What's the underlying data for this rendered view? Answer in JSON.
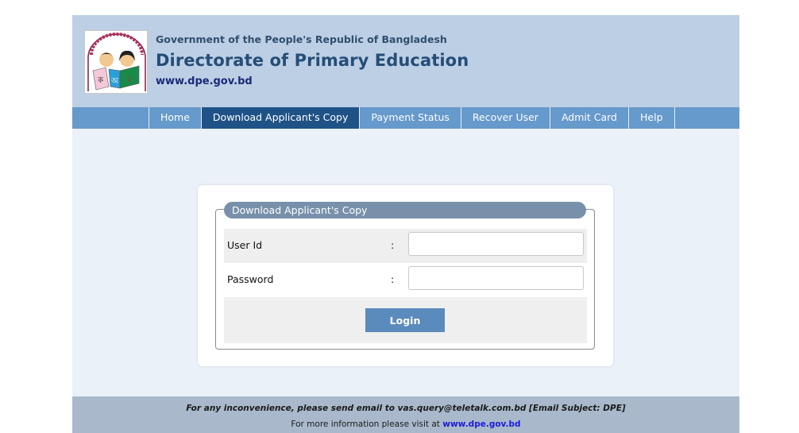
{
  "header": {
    "logo_alt": "DPE logo - children reading",
    "gov_line": "Government of the People's Republic of Bangladesh",
    "title": "Directorate of Primary Education",
    "url": "www.dpe.gov.bd"
  },
  "nav": {
    "items": [
      {
        "label": "Home",
        "active": false
      },
      {
        "label": "Download Applicant's Copy",
        "active": true
      },
      {
        "label": "Payment Status",
        "active": false
      },
      {
        "label": "Recover User",
        "active": false
      },
      {
        "label": "Admit Card",
        "active": false
      },
      {
        "label": "Help",
        "active": false
      }
    ]
  },
  "form": {
    "legend": "Download Applicant's Copy",
    "user_id": {
      "label": "User Id",
      "separator": ":",
      "value": "",
      "placeholder": ""
    },
    "password": {
      "label": "Password",
      "separator": ":",
      "value": "",
      "placeholder": ""
    },
    "login_label": "Login"
  },
  "footer": {
    "line1": "For any inconvenience, please send email to vas.query@teletalk.com.bd [Email Subject: DPE]",
    "line2_prefix": "For more information please visit at",
    "line2_link": "www.dpe.gov.bd"
  },
  "colors": {
    "header_bg": "#bccfe4",
    "nav_bg": "#6699cc",
    "nav_active": "#1f5287",
    "main_bg": "#ebf1f8",
    "legend_bg": "#7890aa",
    "button_bg": "#5b8abc",
    "footer_bg": "#a9b9cb"
  }
}
